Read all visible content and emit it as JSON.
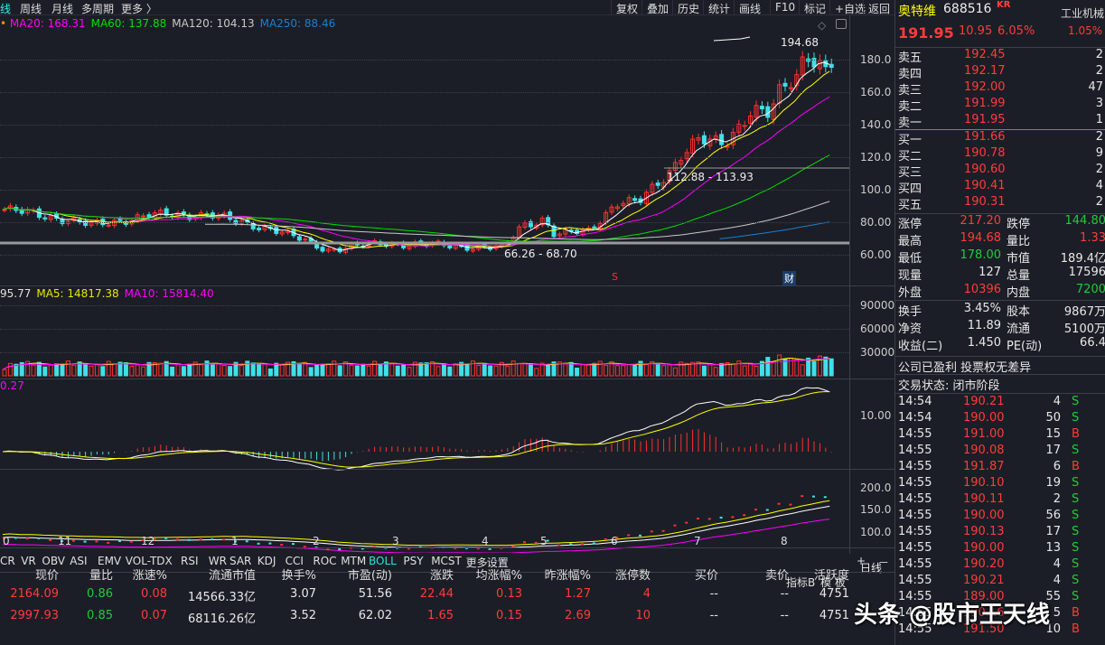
{
  "topbar": {
    "tabs": [
      "线",
      "周线",
      "月线",
      "多周期",
      "更多 〉"
    ],
    "buttons": [
      "复权",
      "叠加",
      "历史",
      "统计",
      "画线",
      "F10",
      "标记",
      "+自选",
      "返回"
    ]
  },
  "ma_legend": [
    {
      "label": "MA20: 168.31",
      "color": "#ff00ff"
    },
    {
      "label": "MA60: 137.88",
      "color": "#00e000"
    },
    {
      "label": "MA120: 104.13",
      "color": "#c8c8c8"
    },
    {
      "label": "MA250: 88.46",
      "color": "#1a7fd0"
    }
  ],
  "price_axis": [
    "180.0",
    "160.0",
    "140.0",
    "120.0",
    "100.0",
    "80.00",
    "60.00"
  ],
  "annotations": {
    "high": "194.68",
    "range1": "112.88 - 113.93",
    "range2": "66.26 - 68.70",
    "marker_s": "S",
    "marker_cai": "财"
  },
  "vol_legend": [
    {
      "label": "95.77",
      "color": "#e0e0e0"
    },
    {
      "label": "MA5: 14817.38",
      "color": "#e8e800"
    },
    {
      "label": "MA10: 15814.40",
      "color": "#ff00ff"
    }
  ],
  "vol_axis": [
    "90000",
    "60000",
    "30000"
  ],
  "macd_legend": "0.27",
  "macd_axis": [
    "10.00"
  ],
  "p4_axis": [
    "200.0",
    "150.0",
    "100.0"
  ],
  "x_axis": [
    "0",
    "11",
    "12",
    "1",
    "2",
    "3",
    "4",
    "5",
    "6",
    "7",
    "8"
  ],
  "indicators": [
    "CR",
    "VR",
    "OBV",
    "ASI",
    "EMV",
    "VOL-TDX",
    "RSI",
    "WR",
    "SAR",
    "KDJ",
    "CCI",
    "ROC",
    "MTM",
    "BOLL",
    "PSY",
    "MCST",
    "更多",
    "设置"
  ],
  "indicator_right": [
    "指标B",
    "模 板",
    "+",
    "－"
  ],
  "period_label": "日线",
  "table": {
    "headers": [
      "现价",
      "量比",
      "涨速%",
      "流通市值",
      "换手%",
      "市盈(动)",
      "涨跌",
      "均涨幅%",
      "昨涨幅%",
      "涨停数",
      "买价",
      "卖价",
      "活跃度"
    ],
    "rows": [
      [
        "2164.09",
        "0.86",
        "0.08",
        "14566.33亿",
        "3.07",
        "51.56",
        "22.44",
        "0.13",
        "1.27",
        "4",
        "--",
        "--",
        "4751"
      ],
      [
        "2997.93",
        "0.85",
        "0.07",
        "68116.26亿",
        "3.52",
        "62.02",
        "1.65",
        "0.15",
        "2.69",
        "10",
        "--",
        "--",
        "4751"
      ]
    ]
  },
  "stock": {
    "name": "奥特维",
    "code": "688516",
    "tag": "KR",
    "price": "191.95",
    "change": "10.95",
    "pct": "6.05%",
    "industry": "工业机械",
    "industry_pct": "1.05%"
  },
  "asks": [
    [
      "卖五",
      "192.45",
      "2"
    ],
    [
      "卖四",
      "192.17",
      "2"
    ],
    [
      "卖三",
      "192.00",
      "47"
    ],
    [
      "卖二",
      "191.99",
      "3"
    ],
    [
      "卖一",
      "191.95",
      "1"
    ]
  ],
  "bids": [
    [
      "买一",
      "191.66",
      "2"
    ],
    [
      "买二",
      "190.78",
      "9"
    ],
    [
      "买三",
      "190.60",
      "2"
    ],
    [
      "买四",
      "190.41",
      "4"
    ],
    [
      "买五",
      "190.31",
      "2"
    ]
  ],
  "stats": [
    [
      "涨停",
      "217.20",
      "跌停",
      "144.80"
    ],
    [
      "最高",
      "194.68",
      "量比",
      "1.33"
    ],
    [
      "最低",
      "178.00",
      "市值",
      "189.4亿"
    ],
    [
      "现量",
      "127",
      "总量",
      "17596"
    ],
    [
      "外盘",
      "10396",
      "内盘",
      "7200"
    ]
  ],
  "stats2": [
    [
      "换手",
      "3.45%",
      "股本",
      "9867万"
    ],
    [
      "净资",
      "11.89",
      "流通",
      "5100万"
    ],
    [
      "收益(二)",
      "1.450",
      "PE(动)",
      "66.4"
    ]
  ],
  "notice": "公司已盈利 投票权无差异",
  "status": "交易状态: 闭市阶段",
  "ticks": [
    [
      "14:54",
      "190.21",
      "4",
      "S"
    ],
    [
      "14:54",
      "190.00",
      "50",
      "S"
    ],
    [
      "14:55",
      "191.00",
      "15",
      "B"
    ],
    [
      "14:55",
      "190.08",
      "17",
      "S"
    ],
    [
      "14:55",
      "191.87",
      "6",
      "B"
    ],
    [
      "14:55",
      "190.10",
      "19",
      "S"
    ],
    [
      "14:55",
      "190.11",
      "2",
      "S"
    ],
    [
      "14:55",
      "190.00",
      "56",
      "S"
    ],
    [
      "14:55",
      "190.13",
      "17",
      "S"
    ],
    [
      "14:55",
      "190.00",
      "13",
      "S"
    ],
    [
      "14:55",
      "190.20",
      "4",
      "S"
    ],
    [
      "14:55",
      "190.21",
      "4",
      "S"
    ],
    [
      "14:55",
      "189.00",
      "55",
      "S"
    ],
    [
      "14:55",
      "190.16",
      "5",
      "B"
    ],
    [
      "14:55",
      "191.50",
      "10",
      "B"
    ]
  ],
  "watermark": "头条 @股市王天线",
  "chart_data": {
    "type": "candlestick",
    "price_path": [
      [
        0,
        88
      ],
      [
        60,
        83
      ],
      [
        100,
        78
      ],
      [
        160,
        84
      ],
      [
        230,
        85
      ],
      [
        260,
        80
      ],
      [
        300,
        76
      ],
      [
        360,
        63
      ],
      [
        420,
        67
      ],
      [
        480,
        66
      ],
      [
        555,
        64
      ],
      [
        575,
        78
      ],
      [
        600,
        82
      ],
      [
        612,
        72
      ],
      [
        650,
        75
      ],
      [
        680,
        92
      ],
      [
        705,
        92
      ],
      [
        740,
        112
      ],
      [
        752,
        122
      ],
      [
        770,
        130
      ],
      [
        800,
        128
      ],
      [
        830,
        150
      ],
      [
        850,
        146
      ],
      [
        862,
        160
      ],
      [
        880,
        170
      ],
      [
        890,
        186
      ],
      [
        905,
        178
      ],
      [
        915,
        172
      ],
      [
        925,
        192
      ]
    ]
  }
}
